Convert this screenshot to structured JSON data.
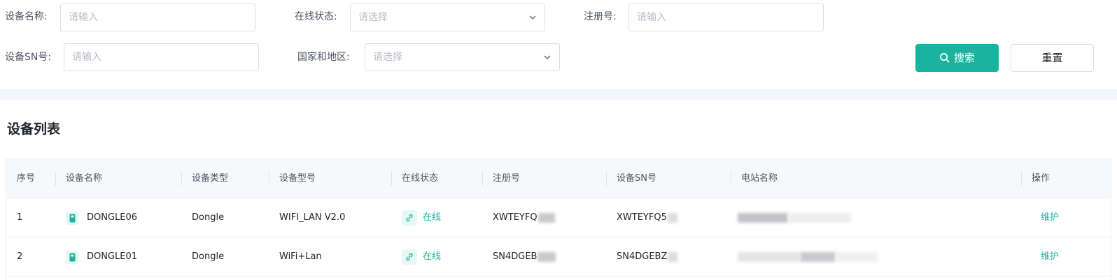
{
  "filters": {
    "device_name": {
      "label": "设备名称:",
      "placeholder": "请输入"
    },
    "online_status": {
      "label": "在线状态:",
      "placeholder": "请选择"
    },
    "registration_no": {
      "label": "注册号:",
      "placeholder": "请输入"
    },
    "device_sn": {
      "label": "设备SN号:",
      "placeholder": "请输入"
    },
    "country_region": {
      "label": "国家和地区:",
      "placeholder": "请选择"
    }
  },
  "buttons": {
    "search": "搜索",
    "reset": "重置"
  },
  "list": {
    "title": "设备列表",
    "columns": [
      "序号",
      "设备名称",
      "设备类型",
      "设备型号",
      "在线状态",
      "注册号",
      "设备SN号",
      "电站名称",
      "操作"
    ],
    "rows": [
      {
        "index": "1",
        "name": "DONGLE06",
        "type": "Dongle",
        "model": "WIFI_LAN V2.0",
        "status": "在线",
        "reg_no": "XWTEYFQ",
        "sn": "XWTEYFQ5",
        "station": "",
        "action": "维护"
      },
      {
        "index": "2",
        "name": "DONGLE01",
        "type": "Dongle",
        "model": "WiFi+Lan",
        "status": "在线",
        "reg_no": "SN4DGEB",
        "sn": "SN4DGEBZ",
        "station": "",
        "action": "维护"
      }
    ]
  },
  "colors": {
    "accent": "#1ab39e",
    "band": "#f4f6f9",
    "border": "#dcdfe6"
  }
}
